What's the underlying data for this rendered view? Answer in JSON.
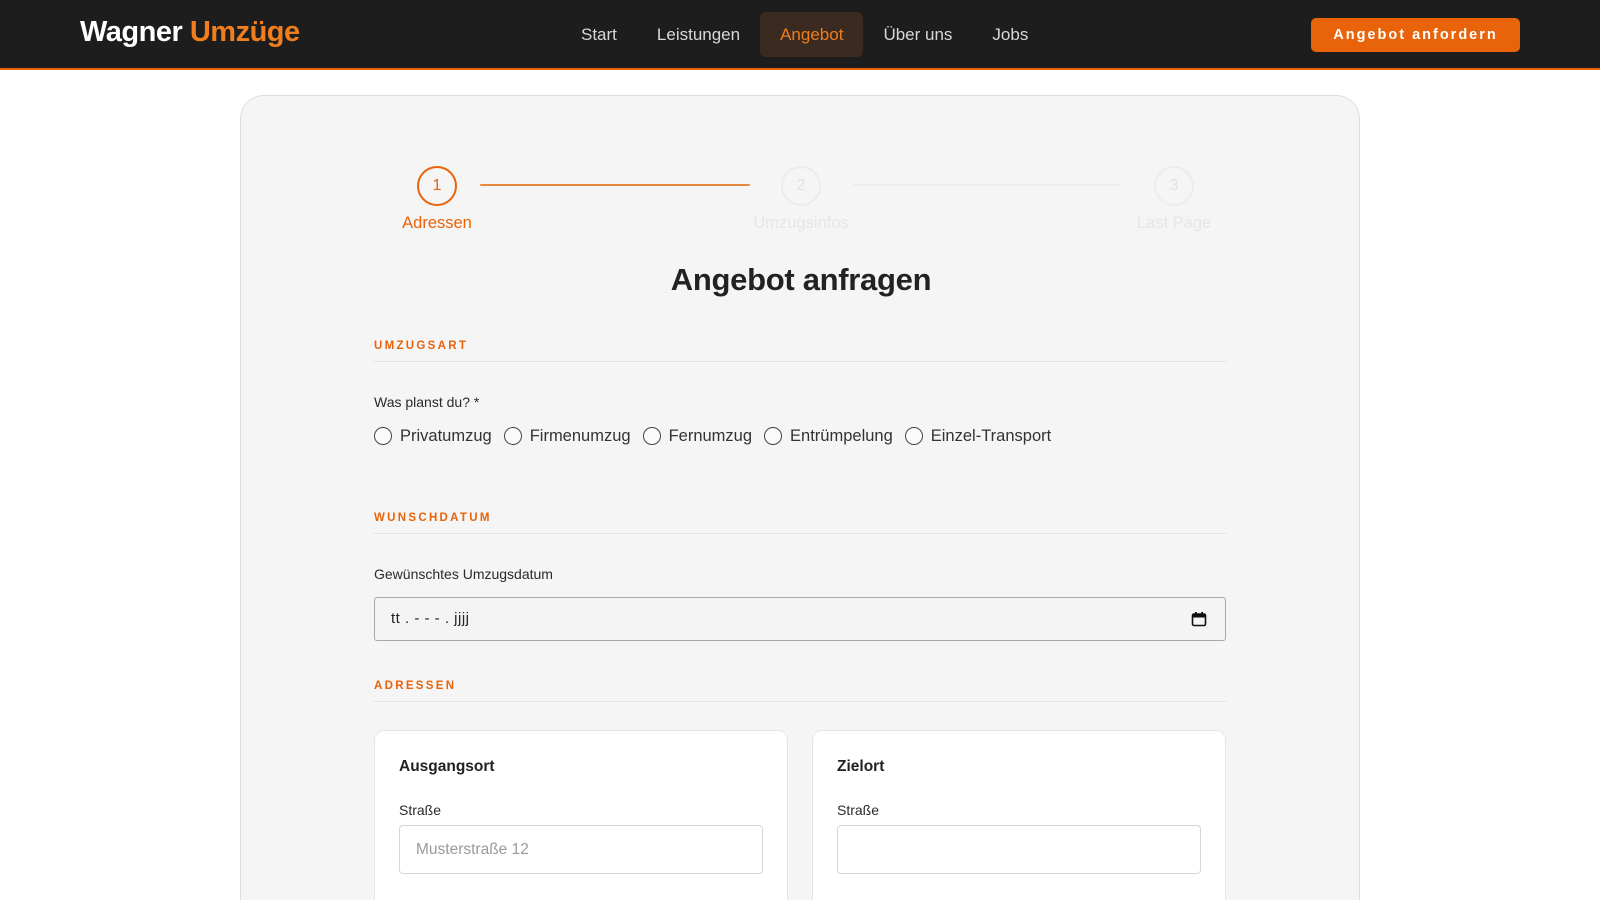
{
  "header": {
    "logo_main": "Wagner",
    "logo_accent": "Umzüge",
    "nav": [
      {
        "label": "Start"
      },
      {
        "label": "Leistungen"
      },
      {
        "label": "Angebot"
      },
      {
        "label": "Über uns"
      },
      {
        "label": "Jobs"
      }
    ],
    "active_nav": "Angebot",
    "cta_label": "Angebot anfordern"
  },
  "stepper": {
    "steps": [
      {
        "number": "1",
        "label": "Adressen",
        "state": "active"
      },
      {
        "number": "2",
        "label": "Umzugsinfos",
        "state": "pending"
      },
      {
        "number": "3",
        "label": "Last Page",
        "state": "pending"
      }
    ]
  },
  "form": {
    "title": "Angebot anfragen",
    "umzugsart": {
      "section_title": "UMZUGSART",
      "question": "Was planst du? *",
      "options": [
        "Privatumzug",
        "Firmenumzug",
        "Fernumzug",
        "Entrümpelung",
        "Einzel-Transport"
      ]
    },
    "wunschdatum": {
      "section_title": "WUNSCHDATUM",
      "label": "Gewünschtes Umzugsdatum",
      "placeholder": "tt . - - - . jjjj"
    },
    "adressen": {
      "section_title": "ADRESSEN",
      "ausgangsort": {
        "title": "Ausgangsort",
        "street_label": "Straße",
        "street_placeholder": "Musterstraße 12",
        "street_value": ""
      },
      "zielort": {
        "title": "Zielort",
        "street_label": "Straße",
        "street_placeholder": "",
        "street_value": ""
      }
    }
  },
  "colors": {
    "accent": "#e8630a",
    "header_bg": "#1d1d1d",
    "card_bg": "#f5f5f5"
  }
}
